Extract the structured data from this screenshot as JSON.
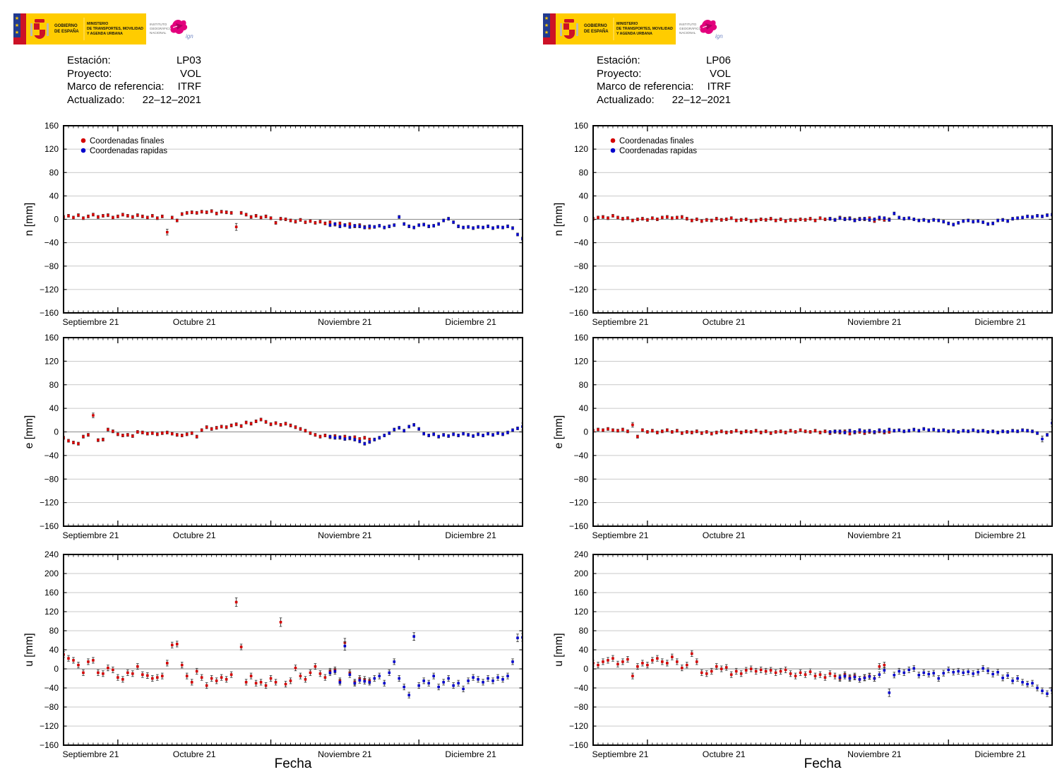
{
  "page": {
    "background": "#ffffff"
  },
  "header": {
    "flag_colors": {
      "blue": "#213a8f",
      "red": "#cc1126",
      "yellow": "#ffcc00"
    },
    "gobierno_lines": [
      "GOBIERNO",
      "DE ESPAÑA"
    ],
    "ministerio_lines": [
      "MINISTERIO",
      "DE TRANSPORTES, MOVILIDAD",
      "Y AGENDA URBANA"
    ],
    "ign_lines": [
      "INSTITUTO",
      "GEOGRÁFICO",
      "NACIONAL"
    ],
    "ign_script": "ign",
    "ign_pink": "#e3007d"
  },
  "stations": [
    {
      "id": "LP03",
      "info": {
        "rows": [
          {
            "label": "Estación:",
            "value": "LP03"
          },
          {
            "label": "Proyecto:",
            "value": "VOL"
          },
          {
            "label": "Marco de referencia:",
            "value": "ITRF"
          },
          {
            "label": "Actualizado:",
            "value": "22–12–2021"
          }
        ]
      }
    },
    {
      "id": "LP06",
      "info": {
        "rows": [
          {
            "label": "Estación:",
            "value": "LP06"
          },
          {
            "label": "Proyecto:",
            "value": "VOL"
          },
          {
            "label": "Marco de referencia:",
            "value": "ITRF"
          },
          {
            "label": "Actualizado:",
            "value": "22–12–2021"
          }
        ]
      }
    }
  ],
  "legend": {
    "items": [
      {
        "label": "Coordenadas finales",
        "color": "#d40000"
      },
      {
        "label": "Coordenadas rapidas",
        "color": "#0000cc"
      }
    ]
  },
  "chart_data": [
    {
      "station": "LP03",
      "component": "n",
      "type": "scatter",
      "ylabel": "n [mm]",
      "xlabel": null,
      "ylim": [
        -160,
        160
      ],
      "ytick_step": 40,
      "grid": true,
      "show_legend": true,
      "x_total_days": 93,
      "x_month_tick_days": [
        11,
        42,
        72
      ],
      "x_tick_labels": [
        "Septiembre 21",
        "Octubre 21",
        "Noviembre 21",
        "Diciembre 21"
      ],
      "series": [
        {
          "name": "Coordenadas finales",
          "color": "#d40000",
          "marker": "square",
          "err_mm": 2.5,
          "err_big": {
            "21": 5,
            "35": 6
          },
          "start_day": 0,
          "values": [
            4,
            6,
            3,
            7,
            2,
            5,
            8,
            4,
            6,
            7,
            3,
            5,
            8,
            6,
            4,
            7,
            5,
            3,
            6,
            2,
            5,
            -22,
            3,
            -2,
            9,
            11,
            12,
            11,
            13,
            12,
            14,
            10,
            13,
            12,
            11,
            -13,
            11,
            8,
            4,
            6,
            3,
            5,
            2,
            -6,
            1,
            0,
            -2,
            -4,
            -1,
            -5,
            -3,
            -6,
            -4,
            -7,
            -5,
            -9,
            -7,
            -10,
            -8,
            -12,
            -10,
            -13,
            -14
          ]
        },
        {
          "name": "Coordenadas rapidas",
          "color": "#0000cc",
          "marker": "square",
          "err_mm": 2.5,
          "err_big": {},
          "start_day": 54,
          "values": [
            -10,
            -8,
            -12,
            -10,
            -13,
            -11,
            -12,
            -14,
            -12,
            -13,
            -11,
            -14,
            -12,
            -10,
            4,
            -8,
            -12,
            -14,
            -10,
            -9,
            -12,
            -11,
            -8,
            -2,
            1,
            -5,
            -12,
            -14,
            -13,
            -15,
            -13,
            -14,
            -12,
            -15,
            -13,
            -14,
            -12,
            -15,
            -26,
            -33
          ]
        }
      ]
    },
    {
      "station": "LP03",
      "component": "e",
      "type": "scatter",
      "ylabel": "e [mm]",
      "xlabel": null,
      "ylim": [
        -160,
        160
      ],
      "ytick_step": 40,
      "grid": true,
      "show_legend": false,
      "x_total_days": 93,
      "x_month_tick_days": [
        11,
        42,
        72
      ],
      "x_tick_labels": [
        "Septiembre 21",
        "Octubre 21",
        "Noviembre 21",
        "Diciembre 21"
      ],
      "series": [
        {
          "name": "Coordenadas finales",
          "color": "#d40000",
          "marker": "square",
          "err_mm": 2.5,
          "err_big": {
            "6": 4
          },
          "start_day": 0,
          "values": [
            -10,
            -15,
            -18,
            -20,
            -8,
            -5,
            28,
            -14,
            -13,
            4,
            1,
            -4,
            -6,
            -5,
            -7,
            0,
            -1,
            -3,
            -2,
            -4,
            -2,
            -1,
            -3,
            -5,
            -6,
            -4,
            -2,
            -8,
            3,
            8,
            5,
            7,
            9,
            8,
            11,
            13,
            10,
            16,
            14,
            18,
            21,
            17,
            13,
            15,
            12,
            14,
            11,
            8,
            5,
            2,
            -2,
            -5,
            -8,
            -6,
            -9,
            -7,
            -10,
            -8,
            -11,
            -9,
            -12,
            -10,
            -13
          ]
        },
        {
          "name": "Coordenadas rapidas",
          "color": "#0000cc",
          "marker": "square",
          "err_mm": 2.5,
          "err_big": {
            "93": 6
          },
          "start_day": 54,
          "values": [
            -8,
            -10,
            -9,
            -12,
            -10,
            -13,
            -16,
            -20,
            -17,
            -13,
            -10,
            -6,
            -2,
            4,
            7,
            2,
            9,
            12,
            5,
            -3,
            -6,
            -4,
            -8,
            -5,
            -7,
            -4,
            -6,
            -3,
            -5,
            -7,
            -4,
            -6,
            -3,
            -5,
            -2,
            -4,
            -1,
            3,
            6,
            9
          ]
        }
      ]
    },
    {
      "station": "LP03",
      "component": "u",
      "type": "scatter",
      "ylabel": "u [mm]",
      "xlabel": "Fecha",
      "ylim": [
        -160,
        240
      ],
      "ytick_step": 40,
      "grid": true,
      "show_legend": false,
      "x_total_days": 93,
      "x_month_tick_days": [
        11,
        42,
        72
      ],
      "x_tick_labels": [
        "Septiembre 21",
        "Octubre 21",
        "Noviembre 21",
        "Diciembre 21"
      ],
      "series": [
        {
          "name": "Coordenadas finales",
          "color": "#d40000",
          "marker": "square",
          "err_mm": 6,
          "err_big": {
            "35": 9,
            "44": 9,
            "57": 9
          },
          "start_day": 0,
          "values": [
            30,
            22,
            18,
            8,
            -8,
            15,
            18,
            -8,
            -10,
            2,
            -2,
            -18,
            -22,
            -8,
            -10,
            5,
            -12,
            -14,
            -20,
            -18,
            -15,
            12,
            50,
            52,
            8,
            -15,
            -28,
            -5,
            -18,
            -35,
            -20,
            -25,
            -18,
            -22,
            -12,
            140,
            46,
            -28,
            -15,
            -30,
            -28,
            -35,
            -20,
            -28,
            98,
            -32,
            -25,
            2,
            -15,
            -22,
            -8,
            5,
            -10,
            -18,
            -5,
            -2,
            -25,
            55,
            -8,
            -28,
            -20,
            -22,
            -25
          ]
        },
        {
          "name": "Coordenadas rapidas",
          "color": "#0000cc",
          "marker": "square",
          "err_mm": 6,
          "err_big": {
            "57": 9,
            "71": 8,
            "92": 8,
            "93": 8
          },
          "start_day": 54,
          "values": [
            -8,
            -5,
            -28,
            48,
            -12,
            -30,
            -24,
            -26,
            -28,
            -20,
            -15,
            -30,
            -8,
            15,
            -20,
            -38,
            -55,
            68,
            -35,
            -25,
            -30,
            -15,
            -38,
            -28,
            -20,
            -35,
            -30,
            -42,
            -25,
            -18,
            -22,
            -28,
            -20,
            -25,
            -18,
            -22,
            -15,
            15,
            65,
            66
          ]
        }
      ]
    },
    {
      "station": "LP06",
      "component": "n",
      "type": "scatter",
      "ylabel": "n [mm]",
      "xlabel": null,
      "ylim": [
        -160,
        160
      ],
      "ytick_step": 40,
      "grid": true,
      "show_legend": true,
      "x_total_days": 93,
      "x_month_tick_days": [
        11,
        42,
        72
      ],
      "x_tick_labels": [
        "Septiembre 21",
        "Octubre 21",
        "Noviembre 21",
        "Diciembre 21"
      ],
      "series": [
        {
          "name": "Coordenadas finales",
          "color": "#d40000",
          "marker": "square",
          "err_mm": 2.5,
          "err_big": {},
          "start_day": 0,
          "values": [
            1,
            3,
            4,
            2,
            6,
            3,
            1,
            2,
            -2,
            0,
            1,
            -1,
            2,
            0,
            3,
            4,
            2,
            3,
            4,
            1,
            -2,
            0,
            -3,
            -1,
            -2,
            1,
            -1,
            0,
            2,
            -2,
            -1,
            0,
            -3,
            -2,
            0,
            -1,
            1,
            -2,
            0,
            -3,
            -1,
            -2,
            0,
            -1,
            1,
            -2,
            2,
            0,
            1,
            -1,
            3,
            1,
            2,
            -1,
            1,
            0,
            2,
            -3,
            1,
            -1,
            0
          ]
        },
        {
          "name": "Coordenadas rapidas",
          "color": "#0000cc",
          "marker": "square",
          "err_mm": 2.5,
          "err_big": {},
          "start_day": 48,
          "values": [
            1,
            -1,
            2,
            0,
            1,
            -2,
            0,
            1,
            -1,
            0,
            3,
            2,
            -1,
            10,
            3,
            1,
            2,
            0,
            -2,
            -1,
            -3,
            -1,
            -2,
            -4,
            -7,
            -9,
            -6,
            -3,
            -2,
            -4,
            -3,
            -5,
            -8,
            -7,
            -2,
            -1,
            -3,
            1,
            2,
            3,
            5,
            4,
            6,
            5,
            7,
            8
          ]
        }
      ]
    },
    {
      "station": "LP06",
      "component": "e",
      "type": "scatter",
      "ylabel": "e [mm]",
      "xlabel": null,
      "ylim": [
        -160,
        160
      ],
      "ytick_step": 40,
      "grid": true,
      "show_legend": false,
      "x_total_days": 93,
      "x_month_tick_days": [
        11,
        42,
        72
      ],
      "x_tick_labels": [
        "Septiembre 21",
        "Octubre 21",
        "Noviembre 21",
        "Diciembre 21"
      ],
      "series": [
        {
          "name": "Coordenadas finales",
          "color": "#d40000",
          "marker": "square",
          "err_mm": 2.5,
          "err_big": {
            "8": 4
          },
          "start_day": 0,
          "values": [
            2,
            4,
            3,
            5,
            3,
            2,
            4,
            1,
            12,
            -8,
            3,
            0,
            2,
            -1,
            1,
            3,
            0,
            2,
            -2,
            0,
            -1,
            1,
            -2,
            0,
            -3,
            -1,
            1,
            -1,
            0,
            2,
            -1,
            1,
            0,
            2,
            -1,
            1,
            -2,
            0,
            1,
            -1,
            2,
            0,
            3,
            1,
            0,
            2,
            -1,
            1,
            -2,
            0,
            -1,
            1,
            -3,
            -1,
            0,
            -2,
            0,
            -1,
            1,
            -1,
            0
          ]
        },
        {
          "name": "Coordenadas rapidas",
          "color": "#0000cc",
          "marker": "square",
          "err_mm": 2.5,
          "err_big": {
            "91": 5,
            "93": 6
          },
          "start_day": 48,
          "values": [
            0,
            1,
            1,
            -1,
            2,
            0,
            3,
            1,
            2,
            0,
            3,
            1,
            4,
            2,
            3,
            1,
            2,
            4,
            2,
            5,
            3,
            4,
            2,
            3,
            1,
            2,
            0,
            2,
            1,
            3,
            1,
            2,
            0,
            1,
            -1,
            1,
            0,
            2,
            1,
            3,
            2,
            1,
            -2,
            -12,
            -5,
            15
          ]
        }
      ]
    },
    {
      "station": "LP06",
      "component": "u",
      "type": "scatter",
      "ylabel": "u [mm]",
      "xlabel": "Fecha",
      "ylim": [
        -160,
        240
      ],
      "ytick_step": 40,
      "grid": true,
      "show_legend": false,
      "x_total_days": 93,
      "x_month_tick_days": [
        11,
        42,
        72
      ],
      "x_tick_labels": [
        "Septiembre 21",
        "Octubre 21",
        "Noviembre 21",
        "Diciembre 21"
      ],
      "series": [
        {
          "name": "Coordenadas finales",
          "color": "#d40000",
          "marker": "square",
          "err_mm": 6,
          "err_big": {},
          "start_day": 0,
          "values": [
            12,
            8,
            15,
            18,
            22,
            10,
            15,
            20,
            -15,
            5,
            12,
            8,
            18,
            22,
            15,
            12,
            25,
            15,
            2,
            8,
            32,
            15,
            -8,
            -10,
            -5,
            5,
            0,
            3,
            -12,
            -5,
            -10,
            -3,
            0,
            -5,
            -2,
            -5,
            -3,
            -8,
            -5,
            -2,
            -10,
            -15,
            -8,
            -12,
            -6,
            -15,
            -12,
            -18,
            -10,
            -15,
            -20,
            -12,
            -18,
            -15,
            -22,
            -18,
            -15,
            -20,
            5,
            8
          ]
        },
        {
          "name": "Coordenadas rapidas",
          "color": "#0000cc",
          "marker": "square",
          "err_mm": 6,
          "err_big": {
            "60": 8
          },
          "start_day": 50,
          "values": [
            -18,
            -15,
            -20,
            -17,
            -22,
            -19,
            -16,
            -20,
            -12,
            -3,
            -50,
            -13,
            -5,
            -8,
            -2,
            1,
            -13,
            -8,
            -11,
            -9,
            -20,
            -9,
            -2,
            -7,
            -5,
            -8,
            -6,
            -10,
            -7,
            1,
            -4,
            -11,
            -7,
            -19,
            -14,
            -25,
            -20,
            -28,
            -32,
            -30,
            -40,
            -46,
            -52,
            -45
          ]
        }
      ]
    }
  ]
}
